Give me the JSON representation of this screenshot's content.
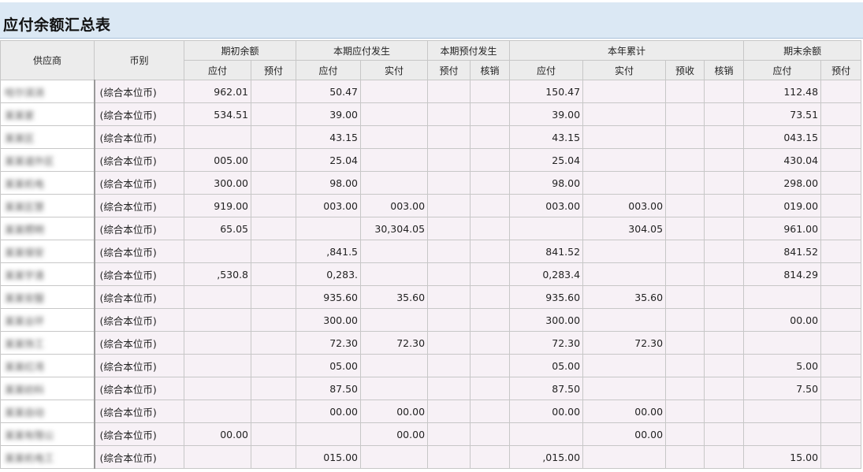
{
  "title": "应付余额汇总表",
  "headers": {
    "supplier": "供应商",
    "currency": "币别",
    "groups": [
      {
        "label": "期初余额",
        "subs": [
          "应付",
          "预付"
        ]
      },
      {
        "label": "本期应付发生",
        "subs": [
          "应付",
          "实付"
        ]
      },
      {
        "label": "本期预付发生",
        "subs": [
          "预付",
          "核销"
        ]
      },
      {
        "label": "本年累计",
        "subs": [
          "应付",
          "实付",
          "预收",
          "核销"
        ]
      },
      {
        "label": "期末余额",
        "subs": [
          "应付",
          "预付"
        ]
      }
    ]
  },
  "rows": [
    {
      "supplier": "哈尔滨消",
      "currency": "(综合本位币)",
      "values": [
        "962.01",
        "",
        "50.47",
        "",
        "",
        "",
        "150.47",
        "",
        "",
        "",
        "112.48",
        ""
      ]
    },
    {
      "supplier": "某某家",
      "currency": "(综合本位币)",
      "values": [
        "534.51",
        "",
        "39.00",
        "",
        "",
        "",
        "39.00",
        "",
        "",
        "",
        "73.51",
        ""
      ]
    },
    {
      "supplier": "某某区",
      "currency": "(综合本位币)",
      "values": [
        "",
        "",
        "43.15",
        "",
        "",
        "",
        "43.15",
        "",
        "",
        "",
        "043.15",
        ""
      ]
    },
    {
      "supplier": "某某道外区",
      "currency": "(综合本位币)",
      "values": [
        "005.00",
        "",
        "25.04",
        "",
        "",
        "",
        "25.04",
        "",
        "",
        "",
        "430.04",
        ""
      ]
    },
    {
      "supplier": "某某机电",
      "currency": "(综合本位币)",
      "values": [
        "300.00",
        "",
        "98.00",
        "",
        "",
        "",
        "98.00",
        "",
        "",
        "",
        "298.00",
        ""
      ]
    },
    {
      "supplier": "某某区慧",
      "currency": "(综合本位币)",
      "values": [
        "919.00",
        "",
        "003.00",
        "003.00",
        "",
        "",
        "003.00",
        "003.00",
        "",
        "",
        "019.00",
        ""
      ]
    },
    {
      "supplier": "某某照明",
      "currency": "(综合本位币)",
      "values": [
        "65.05",
        "",
        "",
        "30,304.05",
        "",
        "",
        "",
        "304.05",
        "",
        "",
        "961.00",
        ""
      ]
    },
    {
      "supplier": "某某保安",
      "currency": "(综合本位币)",
      "values": [
        "",
        "",
        ",841.5",
        "",
        "",
        "",
        "841.52",
        "",
        "",
        "",
        "841.52",
        ""
      ]
    },
    {
      "supplier": "某某宇清",
      "currency": "(综合本位币)",
      "values": [
        ",530.8",
        "",
        "0,283.",
        "",
        "",
        "",
        "0,283.4",
        "",
        "",
        "",
        "814.29",
        ""
      ]
    },
    {
      "supplier": "某某安服",
      "currency": "(综合本位币)",
      "values": [
        "",
        "",
        "935.60",
        "35.60",
        "",
        "",
        "935.60",
        "35.60",
        "",
        "",
        "",
        ""
      ]
    },
    {
      "supplier": "某某业环",
      "currency": "(综合本位币)",
      "values": [
        "",
        "",
        "300.00",
        "",
        "",
        "",
        "300.00",
        "",
        "",
        "",
        "00.00",
        ""
      ]
    },
    {
      "supplier": "某某饰工",
      "currency": "(综合本位币)",
      "values": [
        "",
        "",
        "72.30",
        "72.30",
        "",
        "",
        "72.30",
        "72.30",
        "",
        "",
        "",
        ""
      ]
    },
    {
      "supplier": "某某红湾",
      "currency": "(综合本位币)",
      "values": [
        "",
        "",
        "05.00",
        "",
        "",
        "",
        "05.00",
        "",
        "",
        "",
        "5.00",
        ""
      ]
    },
    {
      "supplier": "某某纺科",
      "currency": "(综合本位币)",
      "values": [
        "",
        "",
        "87.50",
        "",
        "",
        "",
        "87.50",
        "",
        "",
        "",
        "7.50",
        ""
      ]
    },
    {
      "supplier": "某某自动",
      "currency": "(综合本位币)",
      "values": [
        "",
        "",
        "00.00",
        "00.00",
        "",
        "",
        "00.00",
        "00.00",
        "",
        "",
        "",
        ""
      ]
    },
    {
      "supplier": "某某有限公",
      "currency": "(综合本位币)",
      "values": [
        "00.00",
        "",
        "",
        "00.00",
        "",
        "",
        "",
        "00.00",
        "",
        "",
        "",
        ""
      ]
    },
    {
      "supplier": "某某机电工",
      "currency": "(综合本位币)",
      "values": [
        "",
        "",
        "015.00",
        "",
        "",
        "",
        ",015.00",
        "",
        "",
        "",
        "15.00",
        ""
      ]
    }
  ]
}
